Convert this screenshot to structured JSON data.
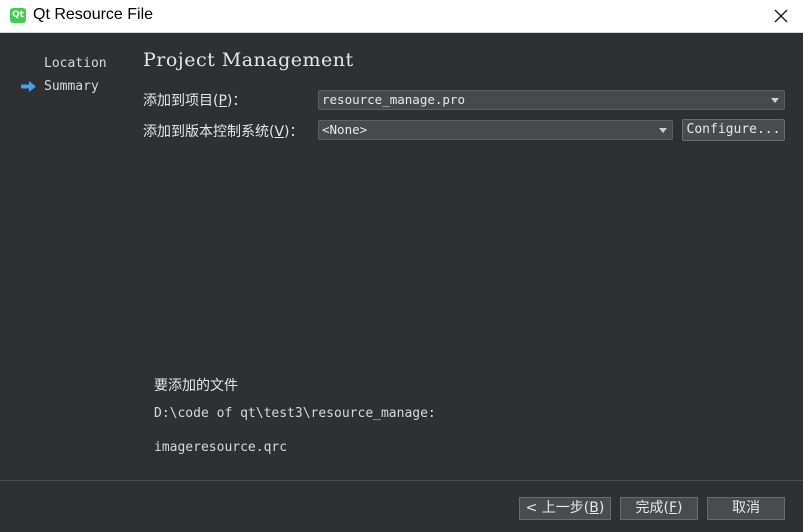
{
  "window": {
    "app_icon_text": "Qt",
    "title": "Qt Resource File"
  },
  "sidebar": {
    "items": [
      {
        "label": "Location"
      },
      {
        "label": "Summary",
        "current": true
      }
    ]
  },
  "main": {
    "title": "Project Management",
    "add_to_project": {
      "label_prefix": "添加到项目(",
      "label_key": "P",
      "label_suffix": ")：",
      "value": "resource_manage.pro"
    },
    "add_to_vcs": {
      "label_prefix": "添加到版本控制系统(",
      "label_key": "V",
      "label_suffix": ")：",
      "value": "<None>",
      "configure_label": "Configure..."
    },
    "files": {
      "title": "要添加的文件",
      "path": "D:\\code of qt\\test3\\resource_manage:",
      "name": "imageresource.qrc"
    }
  },
  "footer": {
    "back_prefix": "< 上一步(",
    "back_key": "B",
    "back_suffix": ")",
    "finish_prefix": "完成(",
    "finish_key": "F",
    "finish_suffix": ")",
    "cancel_label": "取消"
  },
  "colors": {
    "background": "#2f3033",
    "accent_arrow": "#4a9fe6",
    "qt_green": "#41cd52"
  }
}
